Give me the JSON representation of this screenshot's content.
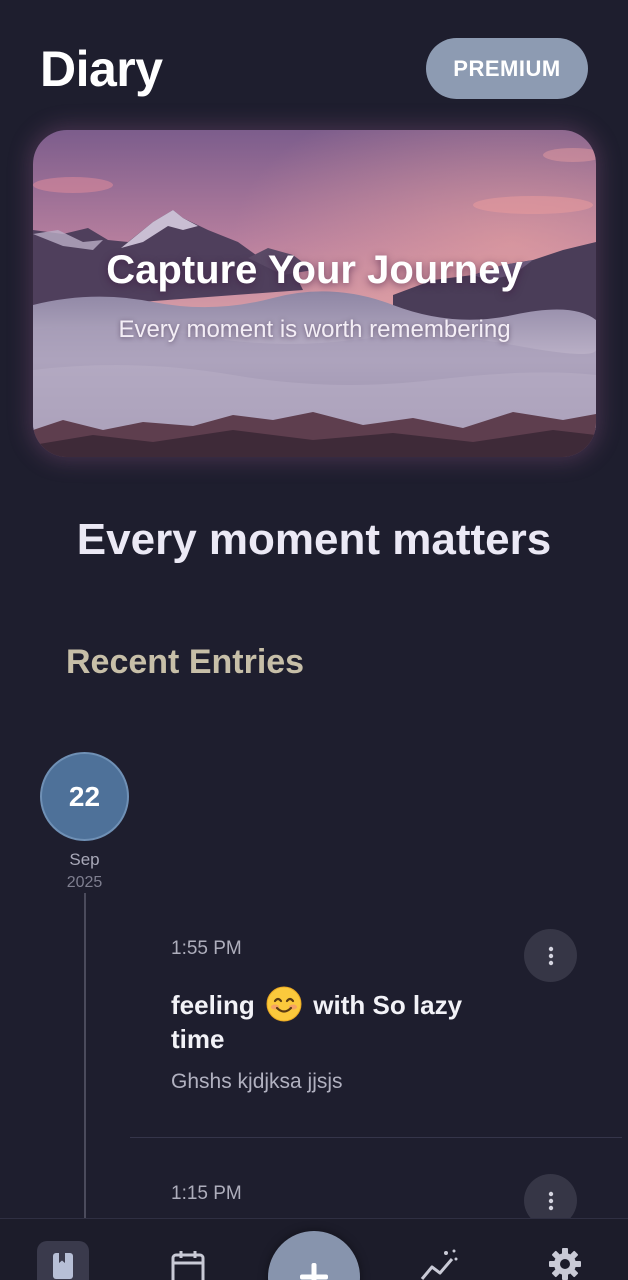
{
  "header": {
    "title": "Diary",
    "premium_label": "PREMIUM"
  },
  "hero": {
    "title": "Capture Your Journey",
    "subtitle": "Every moment is worth remembering"
  },
  "tagline": "Every moment matters",
  "recent_entries": {
    "section_title": "Recent Entries",
    "date_group": {
      "day": "22",
      "month": "Sep",
      "year": "2025"
    },
    "entries": [
      {
        "time": "1:55 PM",
        "title_prefix": "feeling",
        "mood_emoji": "smiling-face-emoji",
        "title_suffix": "with So lazy time",
        "body": "Ghshs kjdjksa jjsjs"
      },
      {
        "time": "1:15 PM"
      }
    ]
  },
  "bottom_nav": {
    "items": [
      {
        "icon": "journal-icon",
        "active": true
      },
      {
        "icon": "calendar-icon",
        "active": false
      },
      {
        "icon": "add-icon",
        "active": false
      },
      {
        "icon": "insights-icon",
        "active": false
      },
      {
        "icon": "gear-icon",
        "active": false
      }
    ]
  },
  "colors": {
    "background": "#1e1e2e",
    "premium_button": "#8d9bb2",
    "date_circle": "#4e7199",
    "section_title": "#c7bfa8",
    "fab": "#8794ad"
  }
}
